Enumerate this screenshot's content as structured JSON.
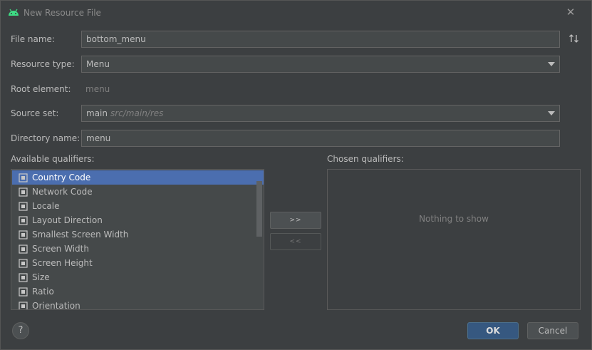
{
  "window": {
    "title": "New Resource File",
    "close_glyph": "✕"
  },
  "form": {
    "file_name_label": "File name:",
    "file_name_value": "bottom_menu",
    "resource_type_label": "Resource type:",
    "resource_type_value": "Menu",
    "root_element_label": "Root element:",
    "root_element_value": "menu",
    "source_set_label": "Source set:",
    "source_set_value": "main",
    "source_set_hint": "src/main/res",
    "directory_name_label": "Directory name:",
    "directory_name_value": "menu"
  },
  "qualifiers": {
    "available_label": "Available qualifiers:",
    "chosen_label": "Chosen qualifiers:",
    "items": [
      {
        "label": "Country Code",
        "icon": "country-code-icon"
      },
      {
        "label": "Network Code",
        "icon": "network-code-icon"
      },
      {
        "label": "Locale",
        "icon": "globe-icon"
      },
      {
        "label": "Layout Direction",
        "icon": "layout-direction-icon"
      },
      {
        "label": "Smallest Screen Width",
        "icon": "smallest-width-icon"
      },
      {
        "label": "Screen Width",
        "icon": "screen-width-icon"
      },
      {
        "label": "Screen Height",
        "icon": "screen-height-icon"
      },
      {
        "label": "Size",
        "icon": "size-icon"
      },
      {
        "label": "Ratio",
        "icon": "ratio-icon"
      },
      {
        "label": "Orientation",
        "icon": "orientation-icon"
      }
    ],
    "selected_index": 0,
    "add_label": ">>",
    "remove_label": "<<",
    "empty_text": "Nothing to show"
  },
  "footer": {
    "help_label": "?",
    "ok_label": "OK",
    "cancel_label": "Cancel"
  },
  "colors": {
    "background": "#3c3f41",
    "field": "#45494a",
    "selection": "#4b6eaf",
    "ok_button": "#365880"
  }
}
